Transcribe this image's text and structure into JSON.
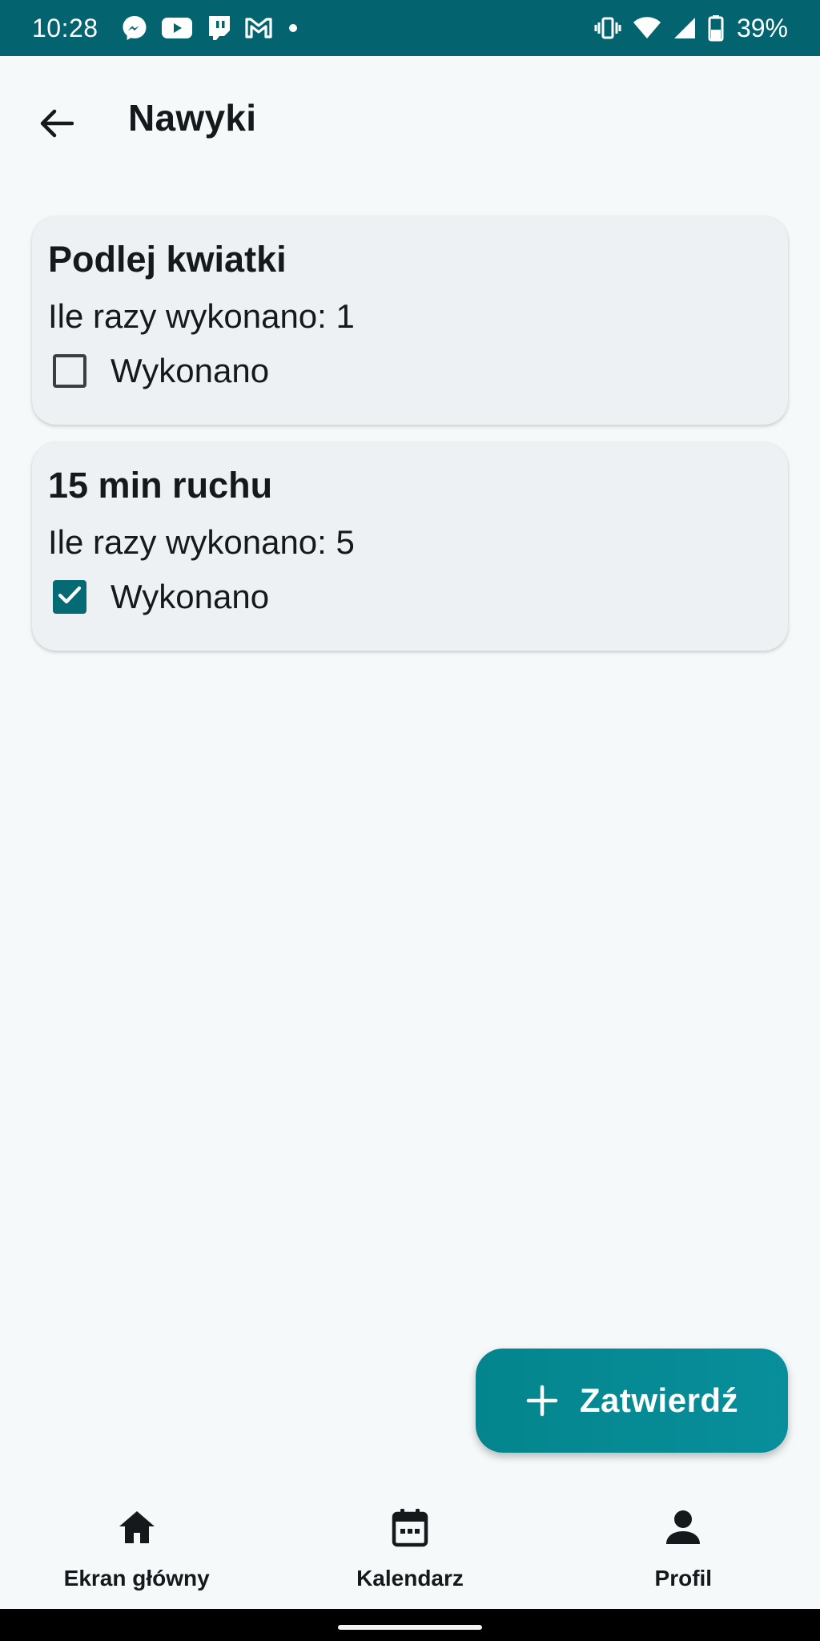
{
  "status_bar": {
    "time": "10:28",
    "battery_text": "39%",
    "left_icons": [
      "messenger-icon",
      "youtube-icon",
      "twitch-icon",
      "gmail-icon",
      "dot-icon"
    ],
    "right_icons": [
      "vibrate-icon",
      "wifi-icon",
      "signal-icon",
      "battery-icon"
    ],
    "background": "#03646f"
  },
  "app_bar": {
    "title": "Nawyki"
  },
  "habits": [
    {
      "title": "Podlej kwiatki",
      "count_text": "Ile razy wykonano: 1",
      "done_label": "Wykonano",
      "checked": false
    },
    {
      "title": "15 min ruchu",
      "count_text": "Ile razy wykonano: 5",
      "done_label": "Wykonano",
      "checked": true
    }
  ],
  "fab": {
    "label": "Zatwierdź",
    "icon": "plus-icon"
  },
  "bottom_nav": {
    "items": [
      {
        "label": "Ekran główny",
        "icon": "home-icon"
      },
      {
        "label": "Kalendarz",
        "icon": "calendar-icon"
      },
      {
        "label": "Profil",
        "icon": "person-icon"
      }
    ]
  },
  "colors": {
    "accent": "#046b75",
    "fab": "#088f9b",
    "card_background": "#eef1f4",
    "page_background": "#f5f9f9"
  }
}
